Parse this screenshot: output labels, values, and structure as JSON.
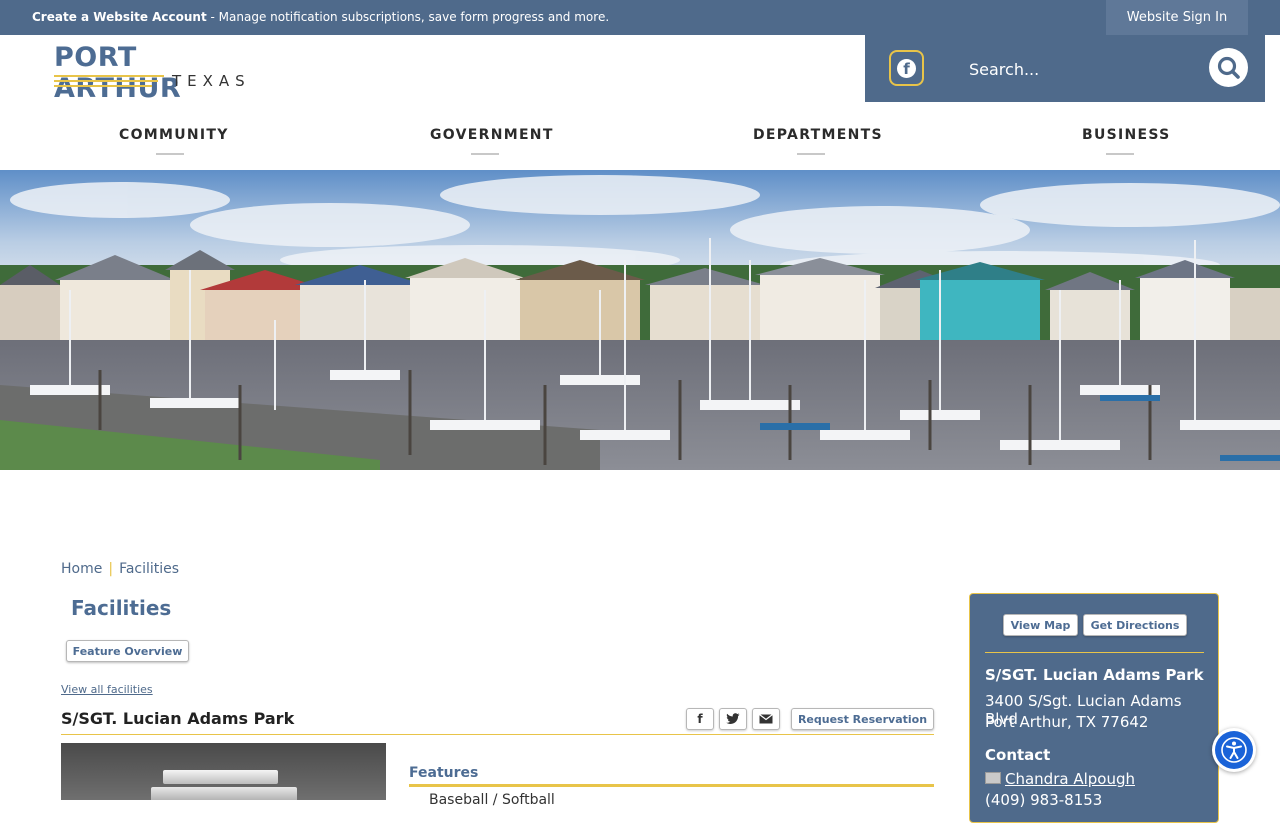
{
  "topbar": {
    "create_account_bold": "Create a Website Account",
    "create_account_rest": " - Manage notification subscriptions, save form progress and more.",
    "sign_in": "Website Sign In"
  },
  "logo": {
    "name": "PORT ARTHUR",
    "state": "TEXAS"
  },
  "header": {
    "search_placeholder": "Search...",
    "facebook_icon": "facebook-icon",
    "search_icon": "search-icon"
  },
  "nav": {
    "items": [
      {
        "label": "COMMUNITY"
      },
      {
        "label": "GOVERNMENT"
      },
      {
        "label": "DEPARTMENTS"
      },
      {
        "label": "BUSINESS"
      }
    ]
  },
  "breadcrumb": {
    "home": "Home",
    "separator": "|",
    "current": "Facilities"
  },
  "main": {
    "page_title": "Facilities",
    "feature_overview": "Feature Overview",
    "view_all": "View all facilities",
    "facility_name": "S/SGT. Lucian Adams Park",
    "share": {
      "facebook": "f",
      "twitter": "twitter",
      "email": "email"
    },
    "request_reservation": "Request Reservation",
    "features_heading": "Features",
    "features_first_item": "Baseball / Softball"
  },
  "sidebar": {
    "view_map": "View Map",
    "get_directions": "Get Directions",
    "park_name": "S/SGT. Lucian Adams Park",
    "address_line1": "3400 S/Sgt. Lucian Adams Blvd",
    "address_line2": "Port Arthur, TX 77642",
    "contact_heading": "Contact",
    "contact_name": "Chandra Alpough",
    "contact_phone": "(409) 983-8153"
  },
  "colors": {
    "brand_blue": "#4f6a8b",
    "accent_gold": "#e8c449",
    "accessibility_blue": "#1a63d8"
  }
}
